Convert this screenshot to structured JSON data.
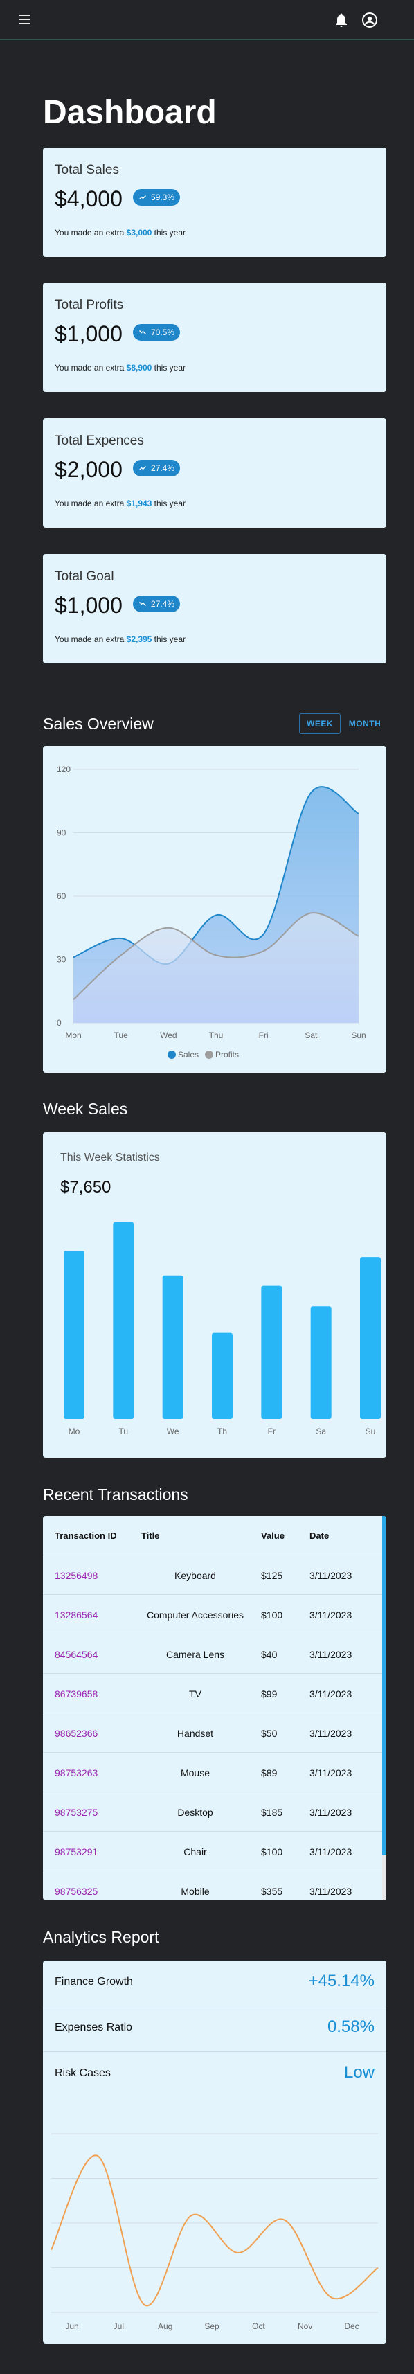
{
  "header": {
    "menu_icon": "hamburger-menu-icon",
    "bell_icon": "bell-icon",
    "user_icon": "account-circle-icon"
  },
  "page_title": "Dashboard",
  "stat_cards": [
    {
      "title": "Total Sales",
      "value": "$4,000",
      "trend_icon": "trending-up-icon",
      "percent": "59.3%",
      "note_prefix": "You made an extra ",
      "note_amount": "$3,000",
      "note_suffix": " this year"
    },
    {
      "title": "Total Profits",
      "value": "$1,000",
      "trend_icon": "trending-down-icon",
      "percent": "70.5%",
      "note_prefix": "You made an extra ",
      "note_amount": "$8,900",
      "note_suffix": " this year"
    },
    {
      "title": "Total Expences",
      "value": "$2,000",
      "trend_icon": "trending-up-icon",
      "percent": "27.4%",
      "note_prefix": "You made an extra ",
      "note_amount": "$1,943",
      "note_suffix": " this year"
    },
    {
      "title": "Total Goal",
      "value": "$1,000",
      "trend_icon": "trending-down-icon",
      "percent": "27.4%",
      "note_prefix": "You made an extra ",
      "note_amount": "$2,395",
      "note_suffix": " this year"
    }
  ],
  "sales_overview": {
    "title": "Sales Overview",
    "toggle_week": "WEEK",
    "toggle_month": "MONTH",
    "selected": "WEEK"
  },
  "week_sales": {
    "title": "Week Sales",
    "subtitle": "This Week Statistics",
    "total": "$7,650"
  },
  "transactions": {
    "title": "Recent Transactions",
    "columns": [
      "Transaction ID",
      "Title",
      "Value",
      "Date"
    ],
    "rows": [
      [
        "13256498",
        "Keyboard",
        "$125",
        "3/11/2023"
      ],
      [
        "13286564",
        "Computer Accessories",
        "$100",
        "3/11/2023"
      ],
      [
        "84564564",
        "Camera Lens",
        "$40",
        "3/11/2023"
      ],
      [
        "86739658",
        "TV",
        "$99",
        "3/11/2023"
      ],
      [
        "98652366",
        "Handset",
        "$50",
        "3/11/2023"
      ],
      [
        "98753263",
        "Mouse",
        "$89",
        "3/11/2023"
      ],
      [
        "98753275",
        "Desktop",
        "$185",
        "3/11/2023"
      ],
      [
        "98753291",
        "Chair",
        "$100",
        "3/11/2023"
      ],
      [
        "98756325",
        "Mobile",
        "$355",
        "3/11/2023"
      ]
    ]
  },
  "analytics": {
    "title": "Analytics Report",
    "rows": [
      {
        "label": "Finance Growth",
        "value": "+45.14%"
      },
      {
        "label": "Expenses Ratio",
        "value": "0.58%"
      },
      {
        "label": "Risk Cases",
        "value": "Low"
      }
    ]
  },
  "colors": {
    "background": "#222427",
    "card": "#e3f4fc",
    "accent": "#1a8fd4",
    "bar": "#29b6f6",
    "sales_line": "#1f86c9",
    "profits_line": "#9e9e9e",
    "analytics_line": "#f0a050",
    "transaction_id": "#9c27b0"
  },
  "chart_data": [
    {
      "type": "area",
      "title": "",
      "x": [
        "Mon",
        "Tue",
        "Wed",
        "Thu",
        "Fri",
        "Sat",
        "Sun"
      ],
      "ylim": [
        0,
        120
      ],
      "yticks": [
        0,
        30,
        60,
        90,
        120
      ],
      "grid": true,
      "legend_position": "bottom",
      "series": [
        {
          "name": "Sales",
          "values": [
            31,
            40,
            28,
            51,
            42,
            109,
            99
          ],
          "color": "#1f86c9"
        },
        {
          "name": "Profits",
          "values": [
            11,
            32,
            45,
            32,
            34,
            52,
            41
          ],
          "color": "#9e9e9e"
        }
      ]
    },
    {
      "type": "bar",
      "title": "",
      "categories": [
        "Mo",
        "Tu",
        "We",
        "Th",
        "Fr",
        "Sa",
        "Su"
      ],
      "values": [
        82,
        96,
        70,
        42,
        65,
        55,
        79
      ],
      "ylim": [
        0,
        100
      ],
      "grid": false
    },
    {
      "type": "line",
      "title": "",
      "x": [
        "Jun",
        "Jul",
        "Aug",
        "Sep",
        "Oct",
        "Nov",
        "Dec"
      ],
      "values": [
        42,
        105,
        5,
        65,
        40,
        62,
        10,
        30
      ],
      "ylim": [
        0,
        120
      ],
      "grid": true
    }
  ]
}
